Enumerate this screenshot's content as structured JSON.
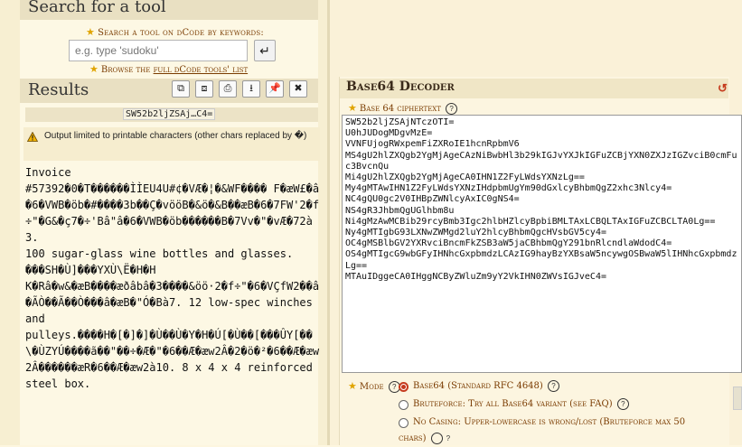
{
  "search": {
    "title": "Search for a tool",
    "keywords_label": "Search a tool on dCode by keywords:",
    "placeholder": "e.g. type 'sudoku'",
    "go_glyph": "↵",
    "browse_prefix": "Browse the ",
    "browse_link": "full dCode tools' list"
  },
  "results": {
    "title": "Results",
    "toolbar": [
      "⧉",
      "⧈",
      "⎙",
      "⭳",
      "📌",
      "✖"
    ],
    "tag": "SW52b2ljZSAj…C4=",
    "warning": "Output limited to printable characters (other chars replaced by �)",
    "text": "Invoice\n#57392�0�T������ÌÌEU4U#¢�VÆ�¦�&WF���� F�æW£�â�6�VWB�öb�#����3b��Ç�vööB�&ö�&B��æB�6�7FW'2�f÷\"�G&�ç7�÷'Bâ\"â�6�VWB�öb������B�7Vv�\"�vÆ�72à3.\n100 sugar-glass wine bottles and glasses.\n���SH�Ù]���YXÙ\\Ë�H�H\nK�Râ�w&�æB����æðâbâ�3����&öö·2�f÷\"�6�VÇfW2��â�ÃÒ��Ã��Ò���â�æB�\"Ó�Bà7. 12 low-spec winches and\npulleys.����H�[�]�]�Ù��Ù�Y�H�Ú[�Ù��[���ÛY[��\\�ÙZYÚ����ã��\"��÷�Æ�\"�6��Æ�æw2Â�2�ö�²�6��Æ�æw2Â������æR�6��Æ�æw2à10. 8 x 4 x 4 reinforced steel box."
  },
  "decoder": {
    "title": "Base64 Decoder",
    "cipher_label": "Base 64 ciphertext",
    "ciphertext": "SW52b2ljZSAjNTczOTI=\nU0hJUDogMDgvMzE=\nVVNFUjogRWxpemFiZXRoIE1hcnRpbmV6\nMS4gU2hlZXQgb2YgMjAgeCAzNiBwbHl3b29kIGJvYXJkIGFuZCBjYXN0ZXJzIGZvciB0cmFuc3BvcnQu\nMi4gU2hlZXQgb2YgMjAgeCA0IHN1Z2FyLWdsYXNzLg==\nMy4gMTAwIHN1Z2FyLWdsYXNzIHdpbmUgYm90dGxlcyBhbmQgZ2xhc3Nlcy4=\nNC4gQU0gc2V0IHBpZWNlcyAxIC0gNS4=\nNS4gR3JhbmQgUGlhbm8u\nNi4gMzAwMCBib29rcyBmb3Igc2hlbHZlcyBpbiBMLTAxLCBQLTAxIGFuZCBCLTA0Lg==\nNy4gMTIgbG93LXNwZWMgd2luY2hlcyBhbmQgcHVsbGV5cy4=\nOC4gMSBlbGV2YXRvciBncmFkZSB3aW5jaCBhbmQgY291bnRlcndlaWdodC4=\nOS4gMTIgcG9wbGFyIHNhcGxpbmdzLCAzIG9hayBzYXBsaW5ncywgOSBwaW5lIHNhcGxpbmdzLg==\nMTAuIDggeCA0IHggNCByZWluZm9yY2VkIHN0ZWVsIGJveC4=",
    "mode_label": "Mode",
    "options": [
      "Base64 (Standard RFC 4648)",
      "Bruteforce: Try all Base64 variant (see FAQ)",
      "No Casing: Upper-lowercase is wrong/lost (Bruteforce max 50 chars)"
    ],
    "selected_option": 0
  },
  "colors": {
    "accent_red": "#c53a1d",
    "label_brown": "#7a3b00",
    "panel_beige": "#fcf5e0"
  }
}
